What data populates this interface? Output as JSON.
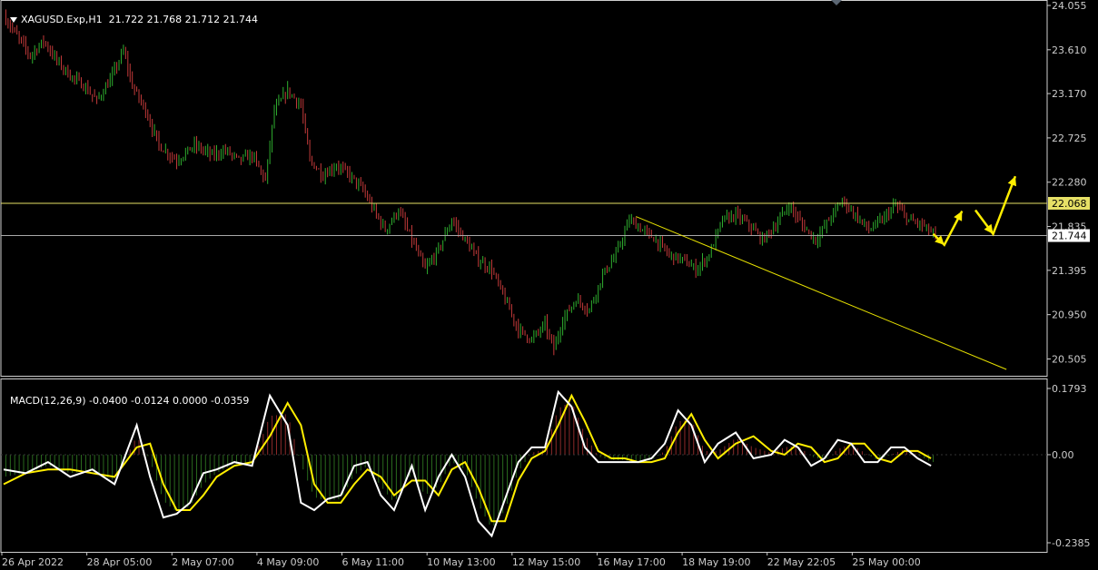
{
  "header": {
    "symbol": "XAGUSD.Exp,H1",
    "ohlc": "21.722 21.768 21.712 21.744"
  },
  "macd_header": {
    "label": "MACD(12,26,9)",
    "values": "-0.0400 -0.0124 0.0000 -0.0359"
  },
  "colors": {
    "background": "#000000",
    "bull": "#2fae2f",
    "bear": "#c43a3a",
    "level_line": "#e6e066",
    "current_line": "#a8a8a8",
    "trendline": "#e6e000",
    "arrows": "#ffee00",
    "macd_line": "#ffffff",
    "signal_line": "#ffee00",
    "hist_pos": "#8c2a2a",
    "hist_neg": "#2a6a1e",
    "axis": "#cccccc"
  },
  "chart_data": [
    {
      "type": "candlestick",
      "title": "XAGUSD.Exp,H1",
      "y_ticks": [
        "24.055",
        "23.610",
        "23.170",
        "22.725",
        "22.280",
        "21.835",
        "21.395",
        "20.950",
        "20.505"
      ],
      "ylim": [
        20.4,
        24.055
      ],
      "x_ticks": [
        "26 Apr 2022",
        "28 Apr 05:00",
        "2 May 07:00",
        "4 May 09:00",
        "6 May 11:00",
        "10 May 13:00",
        "12 May 15:00",
        "16 May 17:00",
        "18 May 19:00",
        "22 May 22:05",
        "25 May 00:00"
      ],
      "price_path": [
        [
          0,
          23.95
        ],
        [
          6,
          23.75
        ],
        [
          12,
          23.55
        ],
        [
          18,
          23.7
        ],
        [
          24,
          23.5
        ],
        [
          30,
          23.35
        ],
        [
          36,
          23.25
        ],
        [
          42,
          23.1
        ],
        [
          48,
          23.3
        ],
        [
          54,
          23.6
        ],
        [
          58,
          23.25
        ],
        [
          64,
          23.0
        ],
        [
          70,
          22.65
        ],
        [
          78,
          22.5
        ],
        [
          86,
          22.65
        ],
        [
          94,
          22.55
        ],
        [
          100,
          22.6
        ],
        [
          106,
          22.5
        ],
        [
          112,
          22.55
        ],
        [
          118,
          22.3
        ],
        [
          122,
          23.0
        ],
        [
          128,
          23.2
        ],
        [
          134,
          23.05
        ],
        [
          138,
          22.5
        ],
        [
          144,
          22.35
        ],
        [
          150,
          22.45
        ],
        [
          156,
          22.35
        ],
        [
          162,
          22.2
        ],
        [
          168,
          21.95
        ],
        [
          172,
          21.8
        ],
        [
          178,
          22.0
        ],
        [
          184,
          21.7
        ],
        [
          190,
          21.4
        ],
        [
          196,
          21.6
        ],
        [
          202,
          21.9
        ],
        [
          208,
          21.7
        ],
        [
          214,
          21.5
        ],
        [
          220,
          21.4
        ],
        [
          226,
          21.1
        ],
        [
          232,
          20.8
        ],
        [
          238,
          20.7
        ],
        [
          244,
          20.85
        ],
        [
          248,
          20.6
        ],
        [
          252,
          20.9
        ],
        [
          258,
          21.1
        ],
        [
          264,
          21.0
        ],
        [
          270,
          21.35
        ],
        [
          276,
          21.55
        ],
        [
          282,
          21.9
        ],
        [
          288,
          21.8
        ],
        [
          294,
          21.7
        ],
        [
          300,
          21.55
        ],
        [
          306,
          21.5
        ],
        [
          312,
          21.4
        ],
        [
          318,
          21.55
        ],
        [
          324,
          21.9
        ],
        [
          330,
          21.95
        ],
        [
          336,
          21.85
        ],
        [
          342,
          21.7
        ],
        [
          348,
          21.85
        ],
        [
          354,
          22.05
        ],
        [
          360,
          21.85
        ],
        [
          366,
          21.7
        ],
        [
          372,
          21.9
        ],
        [
          378,
          22.1
        ],
        [
          384,
          21.95
        ],
        [
          390,
          21.8
        ],
        [
          396,
          21.9
        ],
        [
          402,
          22.05
        ],
        [
          408,
          21.9
        ],
        [
          414,
          21.85
        ],
        [
          420,
          21.74
        ]
      ],
      "current_price": 21.744,
      "levels": [
        22.068
      ],
      "trendline": [
        [
          285.0,
          21.935
        ],
        [
          452.0,
          20.4
        ]
      ],
      "forecast_arrows": [
        [
          [
            419,
            21.76
          ],
          [
            424,
            21.65
          ],
          [
            432,
            21.99
          ]
        ],
        [
          [
            438,
            22.0
          ],
          [
            446,
            21.76
          ],
          [
            456,
            22.34
          ]
        ]
      ]
    },
    {
      "type": "line",
      "title": "MACD(12,26,9)",
      "y_ticks": [
        "0.1793",
        "0.00",
        "-0.2385"
      ],
      "ylim": [
        -0.2385,
        0.1793
      ],
      "series": [
        {
          "name": "MACD",
          "x": [
            0,
            10,
            20,
            30,
            40,
            50,
            60,
            66,
            72,
            78,
            84,
            90,
            96,
            104,
            112,
            120,
            128,
            134,
            140,
            146,
            152,
            158,
            164,
            170,
            176,
            184,
            190,
            196,
            202,
            208,
            214,
            220,
            226,
            232,
            238,
            244,
            250,
            256,
            262,
            268,
            274,
            280,
            286,
            292,
            298,
            304,
            310,
            316,
            322,
            330,
            338,
            346,
            352,
            358,
            364,
            370,
            376,
            382,
            388,
            394,
            400,
            406,
            412,
            418
          ],
          "values": [
            -0.04,
            -0.05,
            -0.02,
            -0.06,
            -0.04,
            -0.08,
            0.08,
            -0.06,
            -0.17,
            -0.16,
            -0.13,
            -0.05,
            -0.04,
            -0.02,
            -0.03,
            0.16,
            0.08,
            -0.13,
            -0.15,
            -0.12,
            -0.11,
            -0.03,
            -0.02,
            -0.11,
            -0.15,
            -0.03,
            -0.15,
            -0.06,
            0.0,
            -0.06,
            -0.18,
            -0.22,
            -0.12,
            -0.02,
            0.02,
            0.02,
            0.17,
            0.13,
            0.02,
            -0.02,
            -0.02,
            -0.02,
            -0.02,
            -0.01,
            0.03,
            0.12,
            0.08,
            -0.02,
            0.03,
            0.06,
            -0.01,
            0.0,
            0.04,
            0.02,
            -0.03,
            -0.01,
            0.04,
            0.03,
            -0.02,
            -0.02,
            0.02,
            0.02,
            -0.01,
            -0.03
          ]
        },
        {
          "name": "Signal",
          "x": [
            0,
            10,
            20,
            30,
            40,
            50,
            60,
            66,
            72,
            78,
            84,
            90,
            96,
            104,
            112,
            120,
            128,
            134,
            140,
            146,
            152,
            158,
            164,
            170,
            176,
            184,
            190,
            196,
            202,
            208,
            214,
            220,
            226,
            232,
            238,
            244,
            250,
            256,
            262,
            268,
            274,
            280,
            286,
            292,
            298,
            304,
            310,
            316,
            322,
            330,
            338,
            346,
            352,
            358,
            364,
            370,
            376,
            382,
            388,
            394,
            400,
            406,
            412,
            418
          ],
          "values": [
            -0.08,
            -0.05,
            -0.04,
            -0.04,
            -0.05,
            -0.06,
            0.02,
            0.03,
            -0.08,
            -0.15,
            -0.15,
            -0.11,
            -0.06,
            -0.03,
            -0.02,
            0.05,
            0.14,
            0.08,
            -0.08,
            -0.13,
            -0.13,
            -0.08,
            -0.04,
            -0.06,
            -0.11,
            -0.07,
            -0.07,
            -0.11,
            -0.04,
            -0.02,
            -0.09,
            -0.18,
            -0.18,
            -0.07,
            -0.01,
            0.01,
            0.08,
            0.16,
            0.09,
            0.01,
            -0.01,
            -0.01,
            -0.02,
            -0.02,
            -0.01,
            0.06,
            0.11,
            0.04,
            -0.01,
            0.03,
            0.05,
            0.01,
            0.0,
            0.03,
            0.02,
            -0.02,
            -0.01,
            0.03,
            0.03,
            -0.01,
            -0.02,
            0.01,
            0.01,
            -0.01
          ]
        }
      ]
    }
  ]
}
